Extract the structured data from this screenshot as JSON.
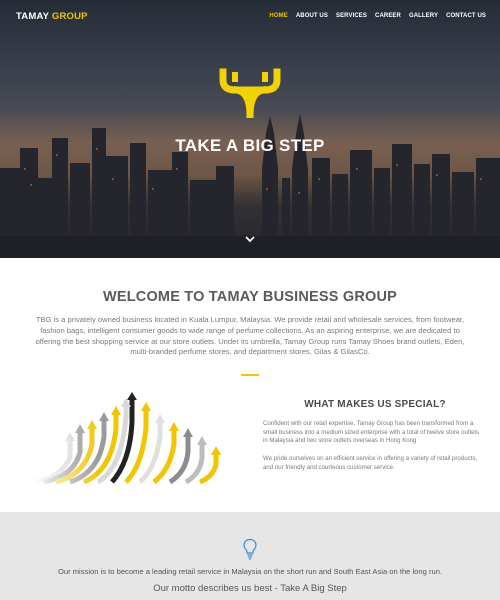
{
  "nav": {
    "brand_part1": "TAMAY",
    "brand_part2": "GROUP",
    "items": [
      {
        "label": "HOME",
        "active": true
      },
      {
        "label": "ABOUT US",
        "active": false
      },
      {
        "label": "SERVICES",
        "active": false
      },
      {
        "label": "CAREER",
        "active": false
      },
      {
        "label": "GALLERY",
        "active": false
      },
      {
        "label": "CONTACT US",
        "active": false
      }
    ]
  },
  "hero": {
    "logo_icon": "tamay-logo-icon",
    "title": "TAKE A BIG STEP",
    "scroll_icon": "chevron-down-icon"
  },
  "welcome": {
    "title": "WELCOME TO TAMAY BUSINESS GROUP",
    "body": "TBG is a privately owned business located in Kuala Lumpur, Malaysia. We provide retail and wholesale services, from footwear, fashion bags, intelligent consumer goods to wide range of perfume collections. As an aspiring enterprise, we are dedicated to offering the best shopping service at our store outlets. Under its umbrella, Tamay Group runs Tamay Shoes brand outlets, Eden, multi-branded perfume stores, and department stores, Gilas & GilasCo."
  },
  "special": {
    "title": "WHAT MAKES US SPECIAL?",
    "paragraph1": "Confident with our retail expertise, Tamay Group has been transformed from a small business into a medium sized enterprise with a total of twelve store outlets in Malaysia and two store outlets overseas in Hong Kong",
    "paragraph2": "We pride ourselves on an efficient service in offering a variety of retail products, and our friendly and courteous customer service."
  },
  "mission": {
    "icon": "lightbulb-icon",
    "text": "Our mission is to become a leading retail service in Malaysia on the short run and South East Asia on the long run.",
    "motto": "Our motto describes us best - Take A Big Step"
  },
  "colors": {
    "accent": "#f2c500",
    "mission_bg": "#e6e6e6",
    "bulb": "#3a8fd0"
  }
}
